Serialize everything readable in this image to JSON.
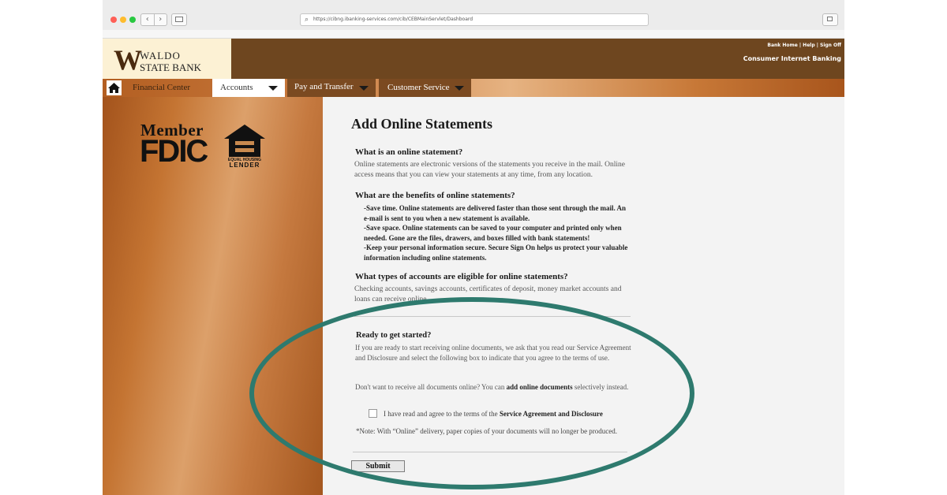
{
  "browser": {
    "url": "https://cibng.ibanking-services.com/cib/CEBMainServlet/Dashboard",
    "back_label": "‹",
    "forward_label": "›"
  },
  "bank": {
    "logo_letter": "W",
    "name_line1": "WALDO",
    "name_line2": "STATE BANK",
    "top_links": "Bank Home | Help | Sign Off",
    "subtitle": "Consumer Internet Banking"
  },
  "nav": {
    "financial_center": "Financial Center",
    "accounts": "Accounts",
    "pay_transfer": "Pay and Transfer",
    "customer_service": "Customer Service"
  },
  "left": {
    "member": "Member",
    "fdic": "FDIC",
    "ehl_small": "EQUAL HOUSING",
    "ehl_big": "LENDER"
  },
  "page": {
    "title": "Add Online Statements",
    "q1": "What is an online statement?",
    "a1": "Online statements are electronic versions of the statements you receive in the mail. Online access means that you can view your statements at any time, from any location.",
    "q2": "What are the benefits of online statements?",
    "b1": "-Save time. Online statements are delivered faster than those sent through the mail. An e-mail is sent to you when a new statement is available.",
    "b2": "-Save space. Online statements can be saved to your computer and printed only when needed. Gone are the files, drawers, and boxes filled with bank statements!",
    "b3": "-Keep your personal information secure. Secure Sign On helps us protect your valuable information including online statements.",
    "q3": "What types of accounts are eligible for online statements?",
    "a3": "Checking accounts, savings accounts, certificates of deposit, money market accounts and loans can receive online",
    "ready_title": "Ready to get started?",
    "ready_text": "If you are ready to start receiving online documents, we ask that you read our Service Agreement and Disclosure and select the following box to indicate that you agree to the terms of use.",
    "alt_text_pre": "Don't want to receive all documents online? You can ",
    "alt_link": "add online documents",
    "alt_text_post": " selectively instead.",
    "checkbox_pre": "I have read and agree to the terms of the ",
    "checkbox_link": "Service Agreement and Disclosure",
    "note": "*Note: With “Online” delivery, paper copies of your documents will no longer be produced.",
    "submit": "Submit"
  },
  "colors": {
    "header_brown": "#6e461f",
    "nav_dark": "#7b4a21",
    "highlight_oval": "#2e7a6e"
  }
}
